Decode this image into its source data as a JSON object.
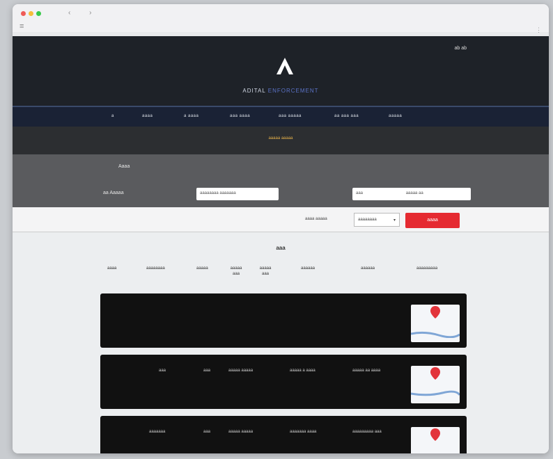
{
  "header": {
    "right_text": "ab ab",
    "brand_prefix": "ADITAL",
    "brand_accent": "ENFORCEMENT"
  },
  "nav": {
    "items": [
      "a",
      "aaaa",
      "a aaaa",
      "aaa aaaa",
      "aaa aaaaa",
      "aa aaa aaa",
      "aaaaa"
    ]
  },
  "subbar": {
    "title": "aaaaa aaaaa"
  },
  "filter": {
    "label1": "Aaaa",
    "label2": "aa Aaaaa",
    "input1_value": "aaaaaaaa aaaaaaa",
    "input2_value": "aaa",
    "input2_trailing": "aaaaa aa"
  },
  "actions": {
    "label": "aaaa aaaaa",
    "select_value": "aaaaaaaa",
    "search_label": "aaaa"
  },
  "results": {
    "title": "aaa",
    "columns": [
      "aaaa",
      "aaaaaaaa",
      "aaaaa",
      "aaaaa aaa",
      "aaaaa aaa",
      "aaaaaa",
      "aaaaaa",
      "aaaaaaaaa"
    ]
  },
  "rows": [
    {
      "cells": [
        "",
        "",
        "",
        "",
        ""
      ]
    },
    {
      "cells": [
        "aaa",
        "aaa",
        "aaaaa aaaaa",
        "aaaaa a aaaa",
        "aaaaa aa aaaa"
      ]
    },
    {
      "cells": [
        "aaaaaaa",
        "aaa",
        "aaaaa aaaaa",
        "aaaaaaa aaaa",
        "aaaaaaaaa aaa"
      ]
    }
  ],
  "colors": {
    "accent_red": "#e52a31",
    "pin_red": "#e2343b",
    "nav_bg": "#1a2235",
    "hero_bg": "#1e2228"
  }
}
